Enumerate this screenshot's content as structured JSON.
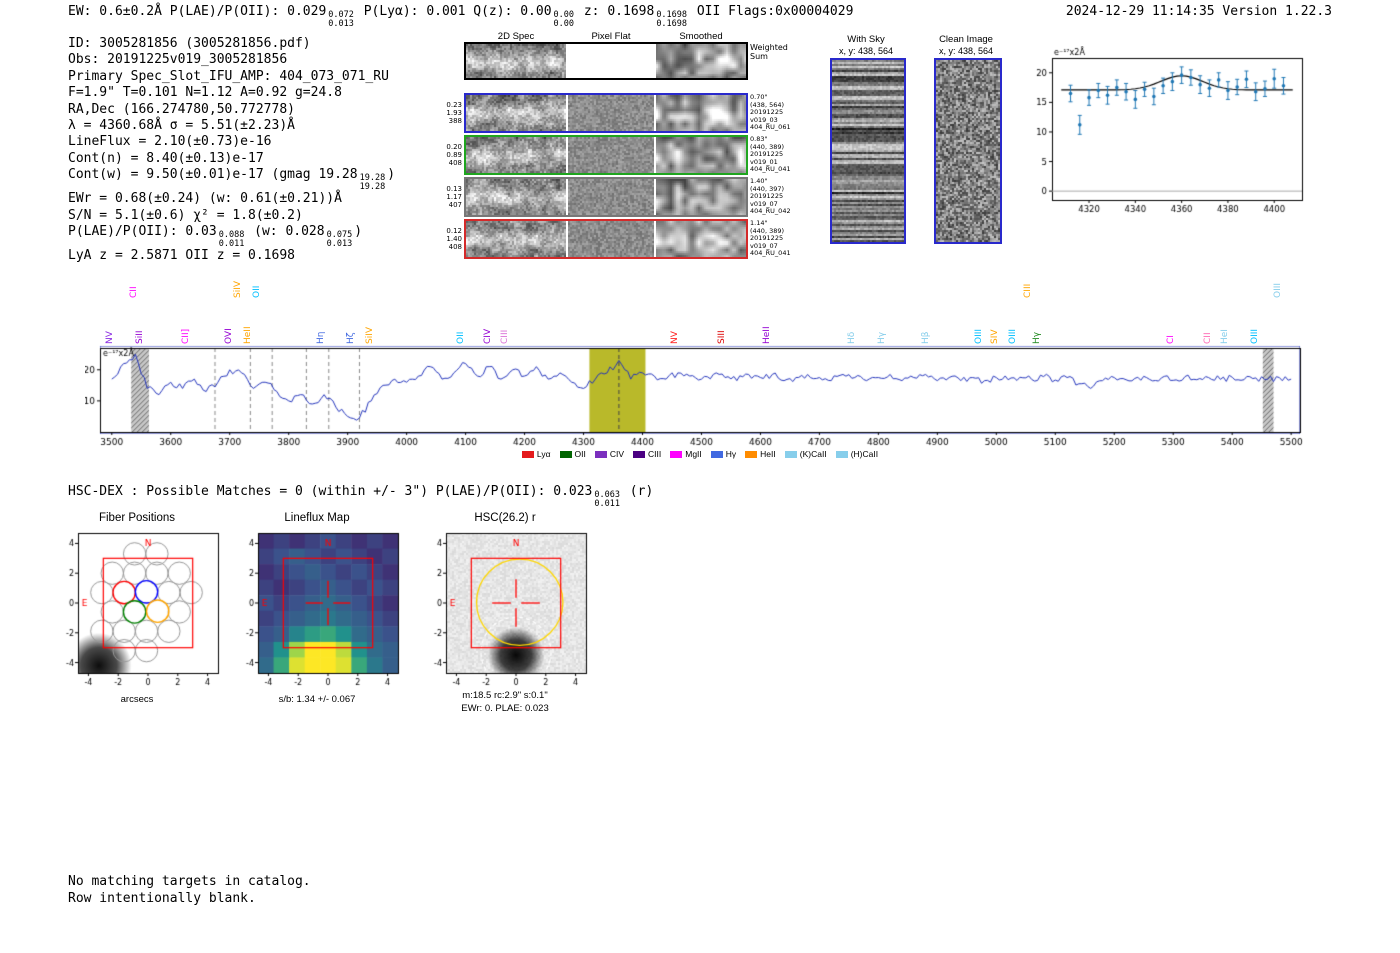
{
  "header": {
    "left_segments": [
      {
        "t": "EW: 0.6±0.2Å  P(LAE)/P(OII): 0.029"
      },
      {
        "sup": "0.072",
        "sub": "0.013"
      },
      {
        "t": "  P(Lyα): 0.001  Q(z): 0.00"
      },
      {
        "sup": "0.00",
        "sub": "0.00"
      },
      {
        "t": " z: 0.1698"
      },
      {
        "sup": "0.1698",
        "sub": "0.1698"
      },
      {
        "t": " OII   Flags:0x00004029"
      }
    ],
    "right": "2024-12-29 11:14:35  Version 1.22.3"
  },
  "info_lines": [
    [
      {
        "t": "ID: 3005281856 (3005281856.pdf)"
      }
    ],
    [
      {
        "t": "Obs: 20191225v019_3005281856"
      }
    ],
    [
      {
        "t": "Primary Spec_Slot_IFU_AMP: 404_073_071_RU"
      }
    ],
    [
      {
        "t": "F=1.9\"  T=0.101  N=1.12  A=0.92  g=24.8"
      }
    ],
    [
      {
        "t": "RA,Dec (166.274780,50.772778)"
      }
    ],
    [
      {
        "t": "λ = 4360.68Å  σ = 5.51(±2.23)Å"
      }
    ],
    [
      {
        "t": "LineFlux = 2.10(±0.73)e-16"
      }
    ],
    [
      {
        "t": "Cont(n) = 8.40(±0.13)e-17"
      }
    ],
    [
      {
        "t": "Cont(w) = 9.50(±0.01)e-17 (gmag 19.28"
      },
      {
        "sup": "19.28",
        "sub": "19.28"
      },
      {
        "t": ")"
      }
    ],
    [
      {
        "t": "EWr = 0.68(±0.24) (w: 0.61(±0.21))Å"
      }
    ],
    [
      {
        "t": "S/N = 5.1(±0.6)  χ² = 1.8(±0.2)"
      }
    ],
    [
      {
        "t": "P(LAE)/P(OII): 0.03"
      },
      {
        "sup": "0.088",
        "sub": "0.011"
      },
      {
        "t": " (w: 0.028"
      },
      {
        "sup": "0.075",
        "sub": "0.013"
      },
      {
        "t": ")"
      }
    ],
    [
      {
        "t": "LyA z = 2.5871  OII z = 0.1698"
      }
    ]
  ],
  "cutouts": {
    "col_titles": [
      "2D Spec",
      "Pixel Flat",
      "Smoothed"
    ],
    "rows": [
      {
        "border": "#000000",
        "left": [],
        "right": [
          "Weighted",
          "Sum"
        ]
      },
      {
        "border": "#2929cc",
        "left": [
          "0.23",
          "1.93",
          "388"
        ],
        "right": [
          "0.70\"",
          "(438, 564)",
          "20191225",
          "v019_03",
          "404_RU_061"
        ]
      },
      {
        "border": "#1fa51f",
        "left": [
          "0.20",
          "0.89",
          "408"
        ],
        "right": [
          "0.83\"",
          "(440, 389)",
          "20191225",
          "v019_01",
          "404_RU_041"
        ]
      },
      {
        "border": "#777777",
        "left": [
          "0.13",
          "1.17",
          "407"
        ],
        "right": [
          "1.40\"",
          "(440, 397)",
          "20191225",
          "v019_07",
          "404_RU_042"
        ]
      },
      {
        "border": "#d42a2a",
        "left": [
          "0.12",
          "1.40",
          "408"
        ],
        "right": [
          "1.14\"",
          "(440, 389)",
          "20191225",
          "v019_07",
          "404_RU_041"
        ]
      }
    ]
  },
  "sky_panel": {
    "title": "With Sky",
    "xy": "x, y: 438, 564"
  },
  "clean_panel": {
    "title": "Clean Image",
    "xy": "x, y: 438, 564"
  },
  "hsc_dex_segments": [
    {
      "t": "HSC-DEX : Possible Matches = 0 (within +/- 3\")  P(LAE)/P(OII): 0.023"
    },
    {
      "sup": "0.063",
      "sub": "0.011"
    },
    {
      "t": " (r)"
    }
  ],
  "footer_lines": [
    "No matching targets in catalog.",
    "Row intentionally blank."
  ],
  "chart_data": [
    {
      "name": "line_fit_plot",
      "type": "scatter",
      "corner_label": "e⁻¹⁷x2Å",
      "x": [
        4312,
        4316,
        4320,
        4324,
        4328,
        4332,
        4336,
        4340,
        4344,
        4348,
        4352,
        4356,
        4360,
        4364,
        4368,
        4372,
        4376,
        4380,
        4384,
        4388,
        4392,
        4396,
        4400,
        4404
      ],
      "y": [
        16.5,
        11.2,
        15.8,
        17.0,
        16.2,
        17.5,
        16.8,
        15.5,
        17.2,
        16.0,
        17.8,
        18.5,
        19.6,
        19.2,
        18.0,
        17.4,
        18.8,
        17.0,
        17.6,
        18.9,
        16.8,
        17.3,
        19.0,
        17.8
      ],
      "yerr": [
        1.4,
        1.6,
        1.3,
        1.2,
        1.5,
        1.3,
        1.4,
        1.5,
        1.2,
        1.4,
        1.3,
        1.5,
        1.4,
        1.3,
        1.5,
        1.4,
        1.2,
        1.5,
        1.3,
        1.4,
        1.5,
        1.3,
        1.6,
        1.4
      ],
      "model": {
        "baseline": 17.1,
        "amplitude": 2.4,
        "center": 4360,
        "sigma": 9
      },
      "xticks": [
        4320,
        4340,
        4360,
        4380,
        4400
      ],
      "yticks": [
        0,
        5,
        10,
        15,
        20
      ],
      "xlim": [
        4304,
        4412
      ],
      "ylim": [
        -1.5,
        22.5
      ],
      "point_color": "#1f77b4"
    },
    {
      "name": "full_spectrum",
      "type": "line",
      "color": "#2233bb",
      "corner_label": "e⁻¹⁷x2Å",
      "x_start": 3500,
      "x_step": 20,
      "values": [
        17,
        22,
        25,
        14,
        12,
        16,
        14,
        17,
        13,
        16,
        20,
        19,
        14,
        16,
        13,
        10,
        12,
        9,
        12,
        8,
        5,
        4.5,
        10,
        15,
        17,
        16,
        18,
        21,
        17,
        19,
        22,
        18,
        21,
        17,
        20,
        18,
        21,
        17,
        19,
        16,
        14,
        17,
        19,
        23,
        17,
        19,
        18,
        17,
        19,
        18,
        17,
        18.5,
        17.5,
        16.5,
        18.5,
        17.5,
        18.5,
        16.5,
        17.5,
        18.5,
        17.5,
        16.5,
        18.5,
        17.5,
        16.5,
        17.5,
        18.5,
        16.5,
        17.5,
        18.5,
        16.5,
        17.5,
        16.5,
        17.5,
        16.5,
        17.5,
        16.8,
        17.6,
        16.9,
        17.8,
        16.7,
        17.5,
        15.5,
        14,
        16.5,
        17.5,
        16.8,
        17.6,
        16.9,
        17.4,
        16.6,
        17.8,
        16.8,
        17.5,
        16.9,
        17.6,
        16.8,
        17.4,
        16.9,
        17.5,
        17.0
      ],
      "xticks": [
        3500,
        3600,
        3700,
        3800,
        3900,
        4000,
        4100,
        4200,
        4300,
        4400,
        4500,
        4600,
        4700,
        4800,
        4900,
        5000,
        5100,
        5200,
        5300,
        5400,
        5500
      ],
      "yticks": [
        10,
        20
      ],
      "xlim": [
        3480,
        5515
      ],
      "ylim": [
        0,
        27
      ],
      "highlight_band": {
        "x0": 4310,
        "x1": 4405,
        "color": "#b9b92a"
      },
      "hatch_bands": [
        [
          3533,
          3563
        ],
        [
          5452,
          5470
        ]
      ],
      "dashed_lines": [
        3675,
        3735,
        3772,
        3830,
        3868,
        3920
      ],
      "center_dashed_line": 4360,
      "line_labels": [
        {
          "t": "NV",
          "wl": 3510,
          "c": "#8a2be2",
          "tier": 0
        },
        {
          "t": "CII",
          "wl": 3552,
          "c": "#ff00ff",
          "tier": 1
        },
        {
          "t": "SiII",
          "wl": 3562,
          "c": "#9400d3",
          "tier": 0
        },
        {
          "t": "CII]",
          "wl": 3640,
          "c": "#ff00ff",
          "tier": 0
        },
        {
          "t": "OVI",
          "wl": 3712,
          "c": "#9400d3",
          "tier": 0
        },
        {
          "t": "SiIV",
          "wl": 3728,
          "c": "#ffa500",
          "tier": 1
        },
        {
          "t": "OII",
          "wl": 3760,
          "c": "#00bfff",
          "tier": 1
        },
        {
          "t": "HeII",
          "wl": 3745,
          "c": "#ffa500",
          "tier": 0
        },
        {
          "t": "Hη",
          "wl": 3868,
          "c": "#4169e1",
          "tier": 0
        },
        {
          "t": "Hζ",
          "wl": 3920,
          "c": "#4169e1",
          "tier": 0
        },
        {
          "t": "SiIV",
          "wl": 3952,
          "c": "#ffa500",
          "tier": 0
        },
        {
          "t": "OII",
          "wl": 4105,
          "c": "#00bfff",
          "tier": 0
        },
        {
          "t": "CIV",
          "wl": 4152,
          "c": "#9400d3",
          "tier": 0
        },
        {
          "t": "CIII",
          "wl": 4180,
          "c": "#da70d6",
          "tier": 0
        },
        {
          "t": "NV",
          "wl": 4468,
          "c": "#ff2222",
          "tier": 0
        },
        {
          "t": "SIII",
          "wl": 4548,
          "c": "#dd0000",
          "tier": 0
        },
        {
          "t": "HeII",
          "wl": 4625,
          "c": "#9400d3",
          "tier": 0
        },
        {
          "t": "Hδ",
          "wl": 4768,
          "c": "#87ceeb",
          "tier": 0
        },
        {
          "t": "Hγ",
          "wl": 4820,
          "c": "#87ceeb",
          "tier": 0
        },
        {
          "t": "Hβ",
          "wl": 4895,
          "c": "#87ceeb",
          "tier": 0
        },
        {
          "t": "OIII",
          "wl": 4985,
          "c": "#00bfff",
          "tier": 0
        },
        {
          "t": "SIV",
          "wl": 5012,
          "c": "#ffa500",
          "tier": 0
        },
        {
          "t": "OIII",
          "wl": 5042,
          "c": "#00bfff",
          "tier": 0
        },
        {
          "t": "CIII",
          "wl": 5068,
          "c": "#ffa500",
          "tier": 1
        },
        {
          "t": "Hγ",
          "wl": 5082,
          "c": "#228b22",
          "tier": 0
        },
        {
          "t": "CI",
          "wl": 5310,
          "c": "#ff00ff",
          "tier": 0
        },
        {
          "t": "CII",
          "wl": 5372,
          "c": "#ff69b4",
          "tier": 0
        },
        {
          "t": "HeI",
          "wl": 5402,
          "c": "#87ceeb",
          "tier": 0
        },
        {
          "t": "OIII",
          "wl": 5452,
          "c": "#00bfff",
          "tier": 0
        },
        {
          "t": "OIII",
          "wl": 5492,
          "c": "#87ceeb",
          "tier": 1
        }
      ],
      "legend": [
        {
          "t": "Lyα",
          "c": "#e41a1c"
        },
        {
          "t": "OII",
          "c": "#006400"
        },
        {
          "t": "CIV",
          "c": "#7b2fbe"
        },
        {
          "t": "CIII",
          "c": "#4b0082"
        },
        {
          "t": "MgII",
          "c": "#ff00ff"
        },
        {
          "t": "Hγ",
          "c": "#4169e1"
        },
        {
          "t": "HeII",
          "c": "#ff8c00"
        },
        {
          "t": "(K)CaII",
          "c": "#87ceeb"
        },
        {
          "t": "(H)CaII",
          "c": "#87ceeb"
        }
      ]
    },
    {
      "name": "fiber_positions",
      "type": "scatter",
      "title": "Fiber Positions",
      "xlabel": "arcsecs",
      "ticks": [
        -4,
        -2,
        0,
        2,
        4
      ],
      "lim": [
        -4.7,
        4.7
      ],
      "fiber_radius": 0.75,
      "gray_fibers": [
        [
          -0.9,
          3.3
        ],
        [
          0.6,
          3.3
        ],
        [
          -2.4,
          2.0
        ],
        [
          -0.9,
          2.0
        ],
        [
          0.6,
          2.0
        ],
        [
          2.1,
          2.0
        ],
        [
          -3.1,
          0.7
        ],
        [
          1.4,
          0.7
        ],
        [
          2.9,
          0.7
        ],
        [
          -2.4,
          -0.6
        ],
        [
          2.1,
          -0.6
        ],
        [
          -3.1,
          -1.9
        ],
        [
          -1.6,
          -1.9
        ],
        [
          -0.1,
          -1.9
        ],
        [
          1.4,
          -1.9
        ],
        [
          -1.6,
          -3.2
        ],
        [
          -0.1,
          -3.2
        ]
      ],
      "colored_fibers": [
        {
          "x": -1.6,
          "y": 0.7,
          "c": "#ff0000"
        },
        {
          "x": -0.1,
          "y": 0.75,
          "c": "#0000ff"
        },
        {
          "x": -0.9,
          "y": -0.6,
          "c": "#008000"
        },
        {
          "x": 0.65,
          "y": -0.55,
          "c": "#ffa500"
        }
      ],
      "square": [
        -3,
        3
      ],
      "north_label": "N",
      "east_label": "E",
      "blob": {
        "x": -3.3,
        "y": -4.2,
        "r": 2.2
      }
    },
    {
      "name": "lineflux_map",
      "type": "heatmap",
      "title": "Lineflux Map",
      "xlabel": "s/b: 1.34 +/- 0.067",
      "ticks": [
        -4,
        -2,
        0,
        2,
        4
      ],
      "lim": [
        -4.7,
        4.7
      ],
      "grid": [
        [
          0.15,
          0.2,
          0.15,
          0.2,
          0.25,
          0.2,
          0.15,
          0.2,
          0.15
        ],
        [
          0.2,
          0.25,
          0.3,
          0.25,
          0.2,
          0.25,
          0.2,
          0.15,
          0.2
        ],
        [
          0.15,
          0.2,
          0.25,
          0.3,
          0.25,
          0.2,
          0.25,
          0.2,
          0.15
        ],
        [
          0.2,
          0.15,
          0.2,
          0.25,
          0.3,
          0.25,
          0.2,
          0.25,
          0.2
        ],
        [
          0.25,
          0.2,
          0.25,
          0.3,
          0.35,
          0.3,
          0.25,
          0.2,
          0.15
        ],
        [
          0.2,
          0.25,
          0.3,
          0.35,
          0.4,
          0.35,
          0.3,
          0.25,
          0.2
        ],
        [
          0.25,
          0.3,
          0.45,
          0.55,
          0.6,
          0.5,
          0.35,
          0.3,
          0.25
        ],
        [
          0.3,
          0.5,
          0.85,
          1.0,
          1.0,
          0.9,
          0.5,
          0.35,
          0.3
        ],
        [
          0.35,
          0.6,
          0.95,
          1.0,
          1.0,
          0.95,
          0.6,
          0.4,
          0.3
        ]
      ],
      "square": [
        -3,
        3
      ],
      "north_label": "N",
      "east_label": "E"
    },
    {
      "name": "hsc_image",
      "type": "image",
      "title": "HSC(26.2) r",
      "xlabel_lines": [
        "m:18.5 rc:2.9\" s:0.1\"",
        "EWr: 0. PLAE: 0.023"
      ],
      "ticks": [
        -4,
        -2,
        0,
        2,
        4
      ],
      "lim": [
        -4.7,
        4.7
      ],
      "square": [
        -3,
        3
      ],
      "aperture_circle": {
        "x": 0.25,
        "y": 0.05,
        "r": 2.9,
        "color": "#ffd700"
      },
      "dashed_circle": {
        "x": 0.0,
        "y": -3.3,
        "r": 2.35,
        "color": "#ffffff"
      },
      "blob": {
        "x": 0.0,
        "y": -3.5,
        "r": 1.9
      },
      "north_label": "N",
      "east_label": "E"
    }
  ]
}
